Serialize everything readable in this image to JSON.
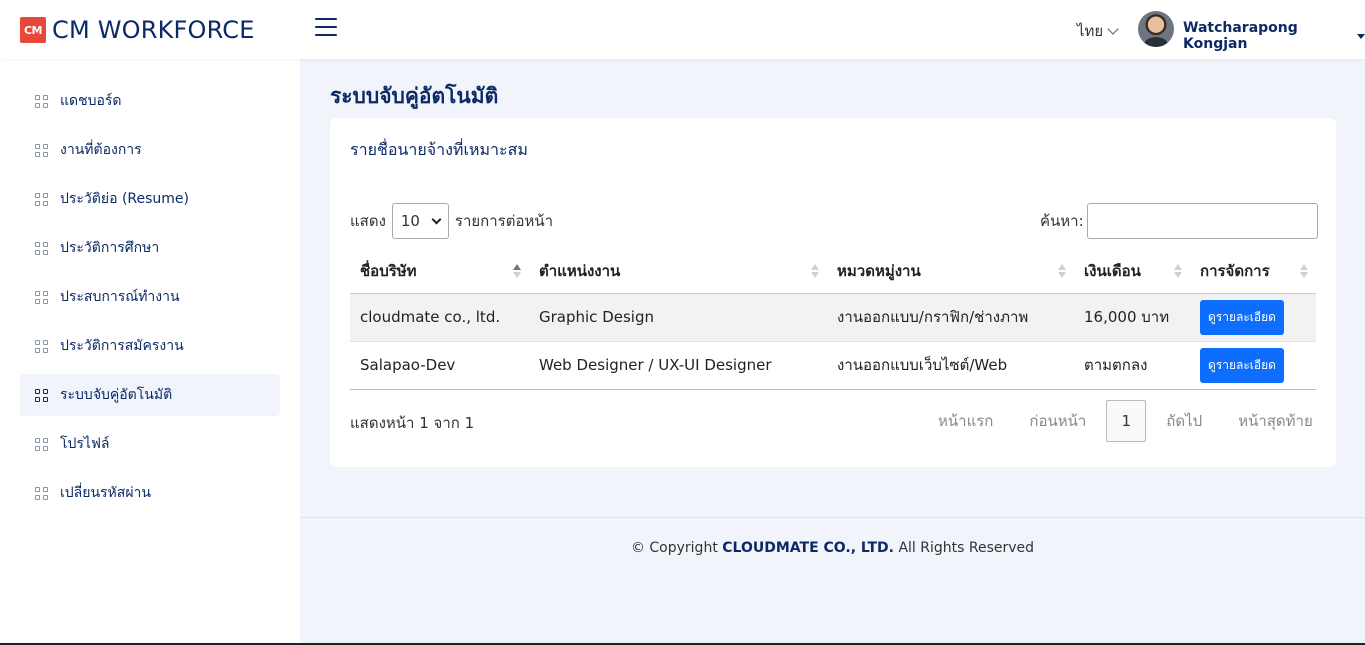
{
  "header": {
    "logo_badge": "CM",
    "logo_text": "CM WORKFORCE",
    "language": "ไทย",
    "user_name": "Watcharapong Kongjan"
  },
  "sidebar": {
    "items": [
      {
        "label": "แดชบอร์ด",
        "active": false
      },
      {
        "label": "งานที่ต้องการ",
        "active": false
      },
      {
        "label": "ประวัติย่อ (Resume)",
        "active": false
      },
      {
        "label": "ประวัติการศึกษา",
        "active": false
      },
      {
        "label": "ประสบการณ์ทำงาน",
        "active": false
      },
      {
        "label": "ประวัติการสมัครงาน",
        "active": false
      },
      {
        "label": "ระบบจับคู่อัตโนมัติ",
        "active": true
      },
      {
        "label": "โปรไฟล์",
        "active": false
      },
      {
        "label": "เปลี่ยนรหัสผ่าน",
        "active": false
      }
    ]
  },
  "main": {
    "page_title": "ระบบจับคู่อัตโนมัติ",
    "card_title": "รายชื่อนายจ้างที่เหมาะสม",
    "length": {
      "prefix": "แสดง",
      "value": "10",
      "suffix": "รายการต่อหน้า"
    },
    "search_label": "ค้นหา:",
    "table": {
      "columns": [
        "ชื่อบริษัท",
        "ตำแหน่งงาน",
        "หมวดหมู่งาน",
        "เงินเดือน",
        "การจัดการ"
      ],
      "rows": [
        {
          "company": "cloudmate co., ltd.",
          "position": "Graphic Design",
          "category": "งานออกแบบ/กราฟิก/ช่างภาพ",
          "salary": "16,000 บาท",
          "action": "ดูรายละเอียด"
        },
        {
          "company": "Salapao-Dev",
          "position": "Web Designer / UX-UI Designer",
          "category": "งานออกแบบเว็บไซต์/Web",
          "salary": "ตามตกลง",
          "action": "ดูรายละเอียด"
        }
      ]
    },
    "info": "แสดงหน้า 1 จาก 1",
    "pager": {
      "first": "หน้าแรก",
      "prev": "ก่อนหน้า",
      "current": "1",
      "next": "ถัดไป",
      "last": "หน้าสุดท้าย"
    }
  },
  "footer": {
    "prefix": "© Copyright",
    "company": "CLOUDMATE CO., LTD.",
    "suffix": "All Rights Reserved"
  }
}
